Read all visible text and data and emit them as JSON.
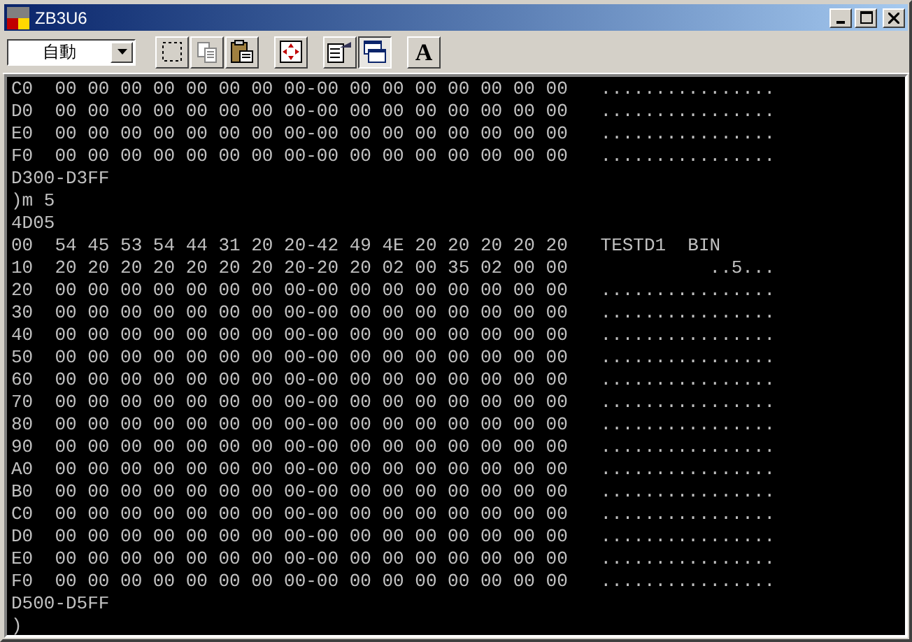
{
  "window": {
    "title": "ZB3U6"
  },
  "toolbar": {
    "font_select": {
      "value": "自動"
    },
    "buttons": [
      {
        "kind": "select",
        "pressed": false
      },
      {
        "kind": "copy",
        "pressed": false
      },
      {
        "kind": "paste",
        "pressed": false
      },
      {
        "kind": "fullscreen",
        "pressed": false
      },
      {
        "kind": "properties",
        "pressed": false
      },
      {
        "kind": "background",
        "pressed": true
      },
      {
        "kind": "font",
        "label": "A",
        "pressed": false
      }
    ]
  },
  "console": {
    "lines": [
      "C0  00 00 00 00 00 00 00 00-00 00 00 00 00 00 00 00   ................",
      "D0  00 00 00 00 00 00 00 00-00 00 00 00 00 00 00 00   ................",
      "E0  00 00 00 00 00 00 00 00-00 00 00 00 00 00 00 00   ................",
      "F0  00 00 00 00 00 00 00 00-00 00 00 00 00 00 00 00   ................",
      "D300-D3FF",
      ")m 5",
      "4D05",
      "00  54 45 53 54 44 31 20 20-42 49 4E 20 20 20 20 20   TESTD1  BIN",
      "10  20 20 20 20 20 20 20 20-20 20 02 00 35 02 00 00             ..5...",
      "20  00 00 00 00 00 00 00 00-00 00 00 00 00 00 00 00   ................",
      "30  00 00 00 00 00 00 00 00-00 00 00 00 00 00 00 00   ................",
      "40  00 00 00 00 00 00 00 00-00 00 00 00 00 00 00 00   ................",
      "50  00 00 00 00 00 00 00 00-00 00 00 00 00 00 00 00   ................",
      "60  00 00 00 00 00 00 00 00-00 00 00 00 00 00 00 00   ................",
      "70  00 00 00 00 00 00 00 00-00 00 00 00 00 00 00 00   ................",
      "80  00 00 00 00 00 00 00 00-00 00 00 00 00 00 00 00   ................",
      "90  00 00 00 00 00 00 00 00-00 00 00 00 00 00 00 00   ................",
      "A0  00 00 00 00 00 00 00 00-00 00 00 00 00 00 00 00   ................",
      "B0  00 00 00 00 00 00 00 00-00 00 00 00 00 00 00 00   ................",
      "C0  00 00 00 00 00 00 00 00-00 00 00 00 00 00 00 00   ................",
      "D0  00 00 00 00 00 00 00 00-00 00 00 00 00 00 00 00   ................",
      "E0  00 00 00 00 00 00 00 00-00 00 00 00 00 00 00 00   ................",
      "F0  00 00 00 00 00 00 00 00-00 00 00 00 00 00 00 00   ................",
      "D500-D5FF",
      ")"
    ]
  }
}
